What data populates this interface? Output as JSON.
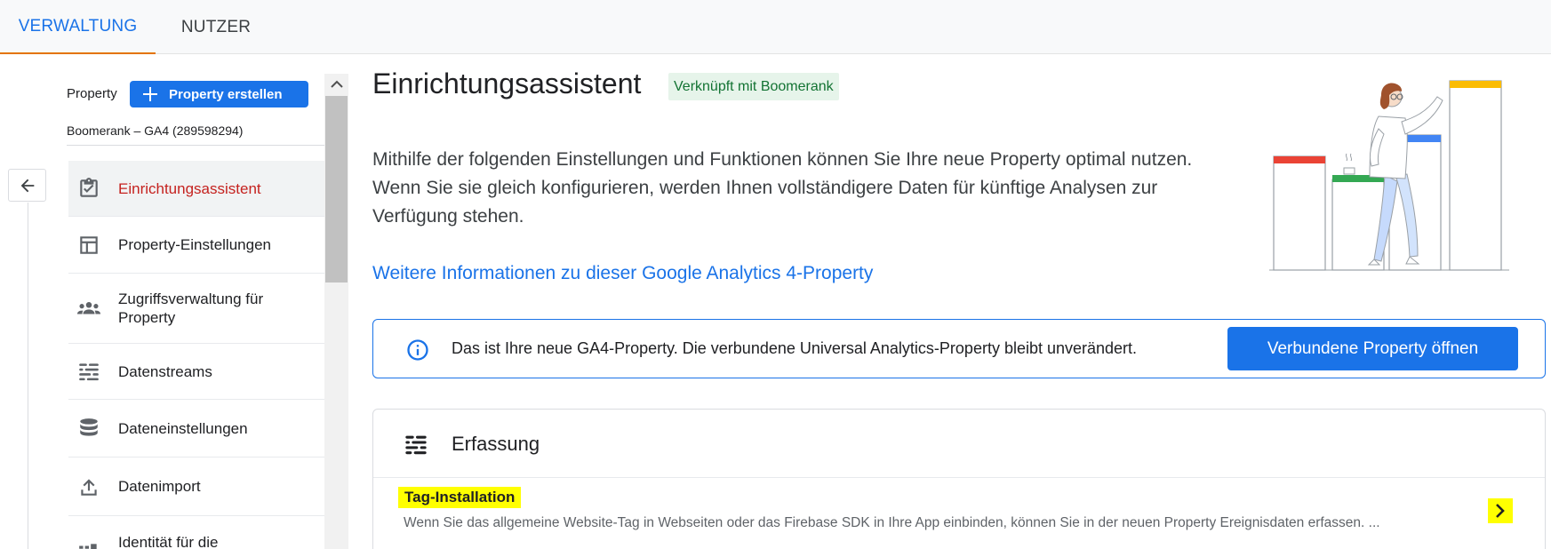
{
  "tabs": [
    {
      "label": "VERWALTUNG",
      "active": true
    },
    {
      "label": "NUTZER",
      "active": false
    }
  ],
  "sidebar": {
    "property_label": "Property",
    "create_button": "Property erstellen",
    "property_name": "Boomerank  – GA4 (289598294)",
    "items": [
      {
        "label": "Einrichtungsassistent",
        "icon": "clipboard-check-icon",
        "active": true
      },
      {
        "label": "Property-Einstellungen",
        "icon": "layout-icon"
      },
      {
        "label": "Zugriffsverwaltung für Property",
        "icon": "people-group-icon"
      },
      {
        "label": "Datenstreams",
        "icon": "data-streams-icon"
      },
      {
        "label": "Dateneinstellungen",
        "icon": "database-icon"
      },
      {
        "label": "Datenimport",
        "icon": "upload-icon"
      },
      {
        "label": "Identität für die",
        "icon": "identity-icon"
      }
    ]
  },
  "main": {
    "title": "Einrichtungsassistent",
    "linked_badge": "Verknüpft mit Boomerank",
    "description": "Mithilfe der folgenden Einstellungen und Funktionen können Sie Ihre neue Property optimal nutzen. Wenn Sie sie gleich konfigurieren, werden Ihnen vollständigere Daten für künftige Analysen zur Verfügung stehen.",
    "more_link": "Weitere Informationen zu dieser Google Analytics 4-Property",
    "info_banner": {
      "text": "Das ist Ihre neue GA4-Property. Die verbundene Universal Analytics-Property bleibt unverändert.",
      "button": "Verbundene Property öffnen"
    },
    "card": {
      "title": "Erfassung",
      "row_title": "Tag-Installation",
      "row_desc": "Wenn Sie das allgemeine Website-Tag in Webseiten oder das Firebase SDK in Ihre App einbinden, können Sie in der neuen Property Ereignisdaten erfassen. ..."
    }
  },
  "colors": {
    "accent": "#1a73e8",
    "active_nav": "#c5221f",
    "badge_bg": "#e6f4ea",
    "badge_text": "#137333",
    "highlight": "#ffff00"
  }
}
